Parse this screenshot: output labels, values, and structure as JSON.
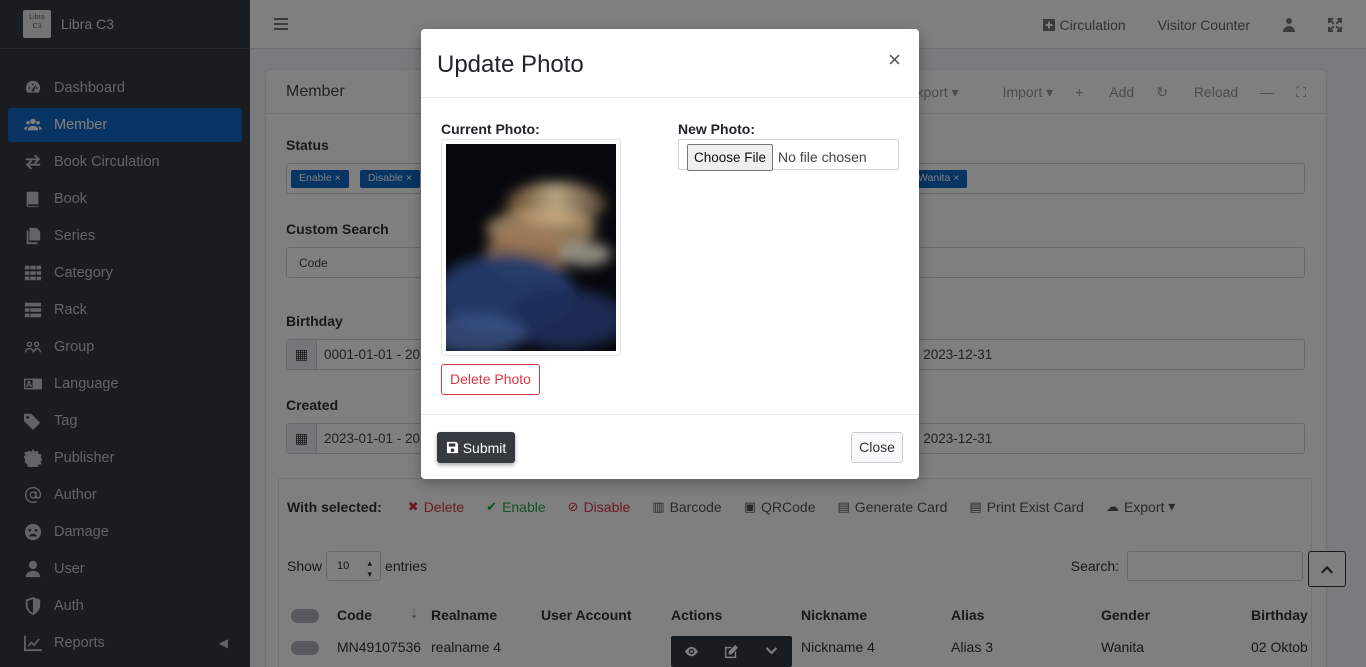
{
  "app": {
    "brand": "Libra C3",
    "logo_text": "Libra C3"
  },
  "sidebar": {
    "items": [
      {
        "label": "Dashboard",
        "icon": "dashboard-icon"
      },
      {
        "label": "Member",
        "icon": "users-icon",
        "active": true
      },
      {
        "label": "Book Circulation",
        "icon": "circulation-icon"
      },
      {
        "label": "Book",
        "icon": "book-icon"
      },
      {
        "label": "Series",
        "icon": "series-icon"
      },
      {
        "label": "Category",
        "icon": "category-icon"
      },
      {
        "label": "Rack",
        "icon": "rack-icon"
      },
      {
        "label": "Group",
        "icon": "group-icon"
      },
      {
        "label": "Language",
        "icon": "language-icon"
      },
      {
        "label": "Tag",
        "icon": "tag-icon"
      },
      {
        "label": "Publisher",
        "icon": "publisher-icon"
      },
      {
        "label": "Author",
        "icon": "author-icon"
      },
      {
        "label": "Damage",
        "icon": "damage-icon"
      },
      {
        "label": "User",
        "icon": "user-icon"
      },
      {
        "label": "Auth",
        "icon": "shield-icon"
      },
      {
        "label": "Reports",
        "icon": "chart-icon"
      }
    ]
  },
  "topnav": {
    "circulation": "Circulation",
    "visitor_counter": "Visitor Counter"
  },
  "card": {
    "title": "Member",
    "tools": {
      "export": "Export",
      "import": "Import",
      "add": "Add",
      "reload": "Reload"
    },
    "status_label": "Status",
    "status_tags": [
      "Enable",
      "Disable",
      "Wanita"
    ],
    "custom_search_label": "Custom Search",
    "custom_search_value": "Code",
    "birthday_label": "Birthday",
    "birthday_from": "0001-01-01 - 20",
    "birthday_to": "- 2023-12-31",
    "created_label": "Created",
    "created_from": "2023-01-01 - 20",
    "created_to": "- 2023-12-31"
  },
  "bulk": {
    "label": "With selected:",
    "actions": [
      "Delete",
      "Enable",
      "Disable",
      "Barcode",
      "QRCode",
      "Generate Card",
      "Print Exist Card",
      "Export"
    ]
  },
  "table": {
    "show": "Show",
    "entries_count": "10",
    "entries": "entries",
    "search_label": "Search:",
    "columns": [
      "Code",
      "Realname",
      "User Account",
      "Actions",
      "Nickname",
      "Alias",
      "Gender",
      "Birthday"
    ],
    "rows": [
      {
        "code": "MN49107536",
        "realname": "realname 4",
        "user_account": "",
        "nickname": "Nickname 4",
        "alias": "Alias 3",
        "gender": "Wanita",
        "birthday": "02 Oktob"
      }
    ]
  },
  "modal": {
    "title": "Update Photo",
    "close_symbol": "×",
    "current_photo_label": "Current Photo:",
    "new_photo_label": "New Photo:",
    "choose_file": "Choose File",
    "no_file": "No file chosen",
    "delete_photo": "Delete Photo",
    "submit": "Submit",
    "close": "Close"
  },
  "colors": {
    "primary": "#0f68c7",
    "sidebar": "#343a40",
    "danger": "#dc3545",
    "success": "#28a745"
  }
}
